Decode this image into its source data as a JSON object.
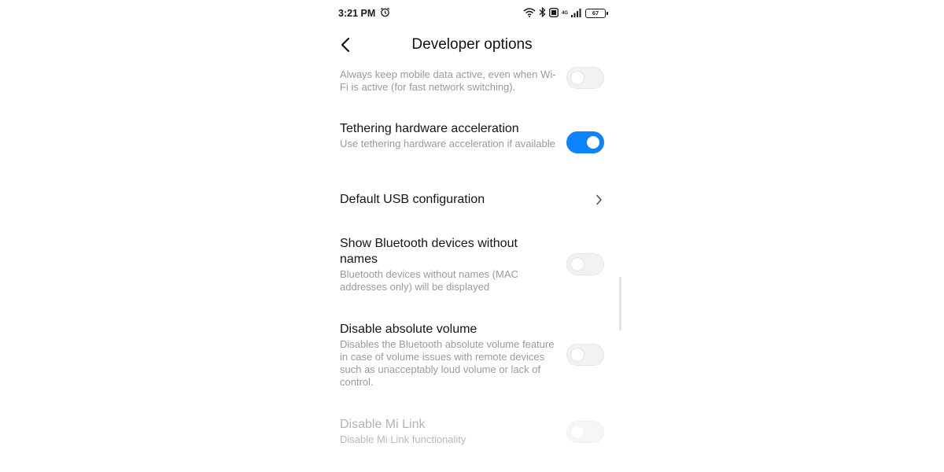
{
  "status": {
    "time": "3:21 PM",
    "network_label": "4G",
    "battery": "67"
  },
  "appbar": {
    "title": "Developer options"
  },
  "settings": [
    {
      "title": "",
      "subtitle": "Always keep mobile data active, even when Wi-Fi is active (for fast network switching).",
      "control": "toggle",
      "state": "off"
    },
    {
      "title": "Tethering hardware acceleration",
      "subtitle": "Use tethering hardware acceleration if available",
      "control": "toggle",
      "state": "on"
    },
    {
      "title": "Default USB configuration",
      "subtitle": "",
      "control": "chevron"
    },
    {
      "title": "Show Bluetooth devices without names",
      "subtitle": "Bluetooth devices without names (MAC addresses only) will be displayed",
      "control": "toggle",
      "state": "off"
    },
    {
      "title": "Disable absolute volume",
      "subtitle": "Disables the Bluetooth absolute volume feature in case of volume issues with remote devices such as unacceptably loud volume or lack of control.",
      "control": "toggle",
      "state": "off"
    },
    {
      "title": "Disable Mi Link",
      "subtitle": "Disable Mi Link functionality",
      "control": "toggle",
      "state": "off",
      "enabled": false
    }
  ],
  "colors": {
    "accent": "#0d84ff",
    "text_primary": "#151515",
    "text_secondary": "#9a9a9a",
    "toggle_off": "#f2f2f2"
  },
  "icons": [
    "alarm-icon",
    "wifi-icon",
    "bluetooth-icon",
    "volte-icon",
    "signal-icon",
    "battery-icon",
    "back-icon",
    "chevron-right-icon"
  ]
}
